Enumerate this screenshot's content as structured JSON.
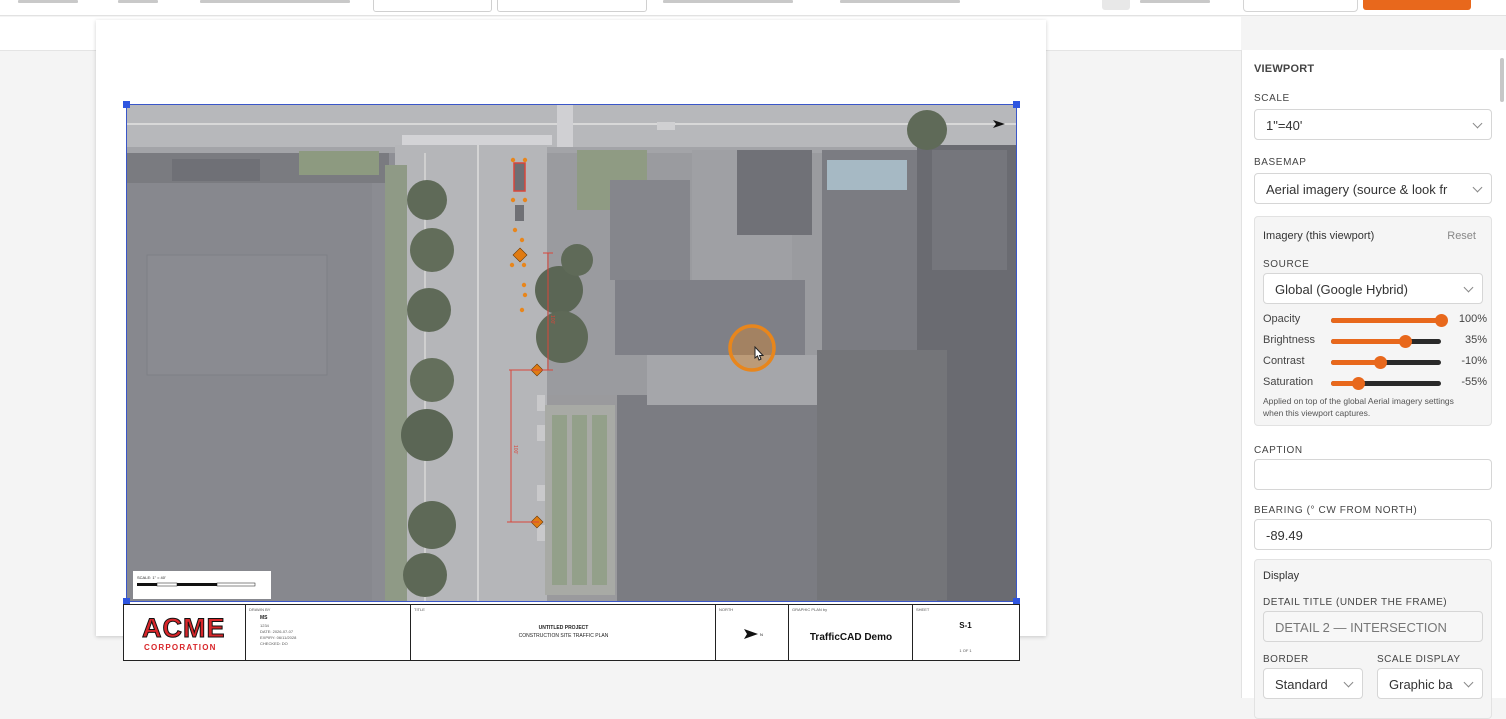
{
  "panel": {
    "heading": "VIEWPORT",
    "scale_label": "SCALE",
    "scale_value": "1\"=40'",
    "basemap_label": "BASEMAP",
    "basemap_value": "Aerial imagery (source & look fr",
    "imagery": {
      "title": "Imagery (this viewport)",
      "reset": "Reset",
      "source_label": "SOURCE",
      "source_value": "Global (Google Hybrid)",
      "sliders": [
        {
          "label": "Opacity",
          "value": "100%",
          "level": 1.0
        },
        {
          "label": "Brightness",
          "value": "35%",
          "level": 0.675
        },
        {
          "label": "Contrast",
          "value": "-10%",
          "level": 0.45
        },
        {
          "label": "Saturation",
          "value": "-55%",
          "level": 0.25
        }
      ],
      "note": "Applied on top of the global Aerial imagery settings when this viewport captures."
    },
    "caption_label": "CAPTION",
    "caption_value": "",
    "bearing_label": "BEARING (° CW FROM NORTH)",
    "bearing_value": "-89.49",
    "display": {
      "title": "Display",
      "detail_title_label": "DETAIL TITLE (UNDER THE FRAME)",
      "detail_title_placeholder": "DETAIL 2 — INTERSECTION",
      "border_label": "BORDER",
      "border_value": "Standard",
      "scale_display_label": "SCALE DISPLAY",
      "scale_display_value": "Graphic ba"
    }
  },
  "sheet": {
    "logo_top": "ACME",
    "logo_bottom": "CORPORATION",
    "drawn_by_label": "DRAWN BY",
    "drawn_by": "MS",
    "drawn_lines": [
      "1234",
      "DATE: 2026-07-07",
      "EXPIRY: 06/11/2028",
      "CHECKED: DO"
    ],
    "title_label": "TITLE",
    "project_title": "UNTITLED PROJECT",
    "project_subtitle": "CONSTRUCTION SITE TRAFFIC PLAN",
    "north_label": "NORTH",
    "plan_by_label": "GRAPHIC PLAN by",
    "plan_by": "TrafficCAD Demo",
    "sheet_label": "SHEET",
    "sheet_number": "S-1",
    "sheet_of": "1 OF 1",
    "scale_text": "SCALE: 1\" = 40'",
    "dim1": "100'",
    "dim2": "100'"
  }
}
